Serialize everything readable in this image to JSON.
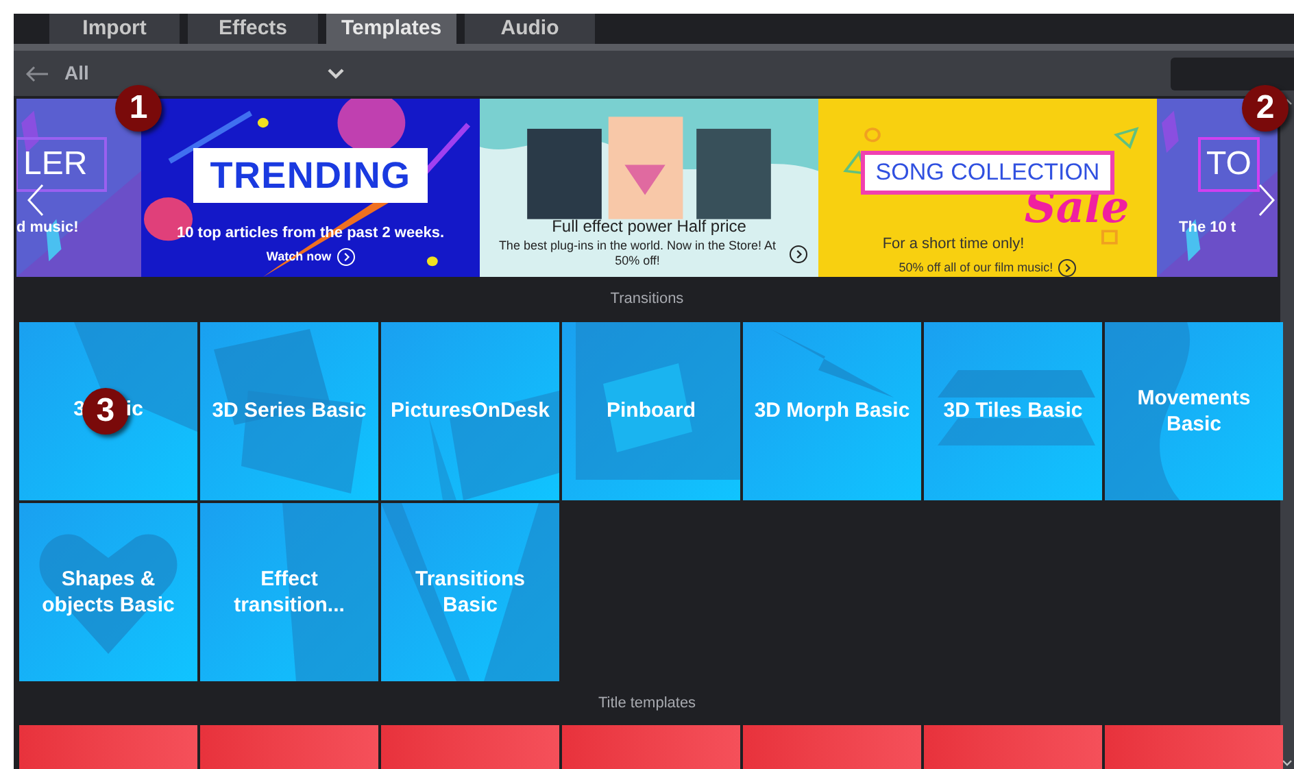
{
  "tabs": [
    {
      "label": "Import",
      "selected": false
    },
    {
      "label": "Effects",
      "selected": false
    },
    {
      "label": "Templates",
      "selected": true
    },
    {
      "label": "Audio",
      "selected": false
    }
  ],
  "filter": {
    "category": "All"
  },
  "banners": [
    {
      "kind": "partial-left",
      "headline": "LER",
      "line1": "d music!"
    },
    {
      "kind": "trending",
      "headline": "TRENDING",
      "line1": "10 top articles from the past 2 weeks.",
      "link": "Watch now"
    },
    {
      "kind": "product",
      "headline": "Full effect power Half price",
      "line1": "The best plug-ins in the world. Now in the Store! At 50% off!"
    },
    {
      "kind": "sale",
      "headline": "SONG COLLECTION",
      "accent": "Sale",
      "line1": "For a short time only!",
      "link": "50% off all of our film music!"
    },
    {
      "kind": "partial-right",
      "headline": "TO",
      "line1": "The 10 t"
    }
  ],
  "callouts": [
    "1",
    "2",
    "3"
  ],
  "sections": [
    {
      "title": "Transitions",
      "tiles": [
        {
          "label_parts": [
            "3",
            "ic"
          ],
          "kind": "slab"
        },
        {
          "label": "3D Series Basic",
          "kind": "squares"
        },
        {
          "label": "PicturesOnDesk",
          "kind": "desk"
        },
        {
          "label": "Pinboard",
          "kind": "pin"
        },
        {
          "label": "3D Morph Basic",
          "kind": "plane"
        },
        {
          "label": "3D Tiles Basic",
          "kind": "tiles"
        },
        {
          "label": "Movements Basic",
          "kind": "wave"
        },
        {
          "label": "Shapes & objects Basic",
          "kind": "heart"
        },
        {
          "label": "Effect transition...",
          "kind": "beams"
        },
        {
          "label": "Transitions Basic",
          "kind": "triangle"
        }
      ]
    },
    {
      "title": "Title templates",
      "tiles": [
        {
          "kind": "red"
        },
        {
          "kind": "red"
        },
        {
          "kind": "red"
        },
        {
          "kind": "red"
        },
        {
          "kind": "red"
        },
        {
          "kind": "red"
        },
        {
          "kind": "red"
        }
      ]
    }
  ]
}
